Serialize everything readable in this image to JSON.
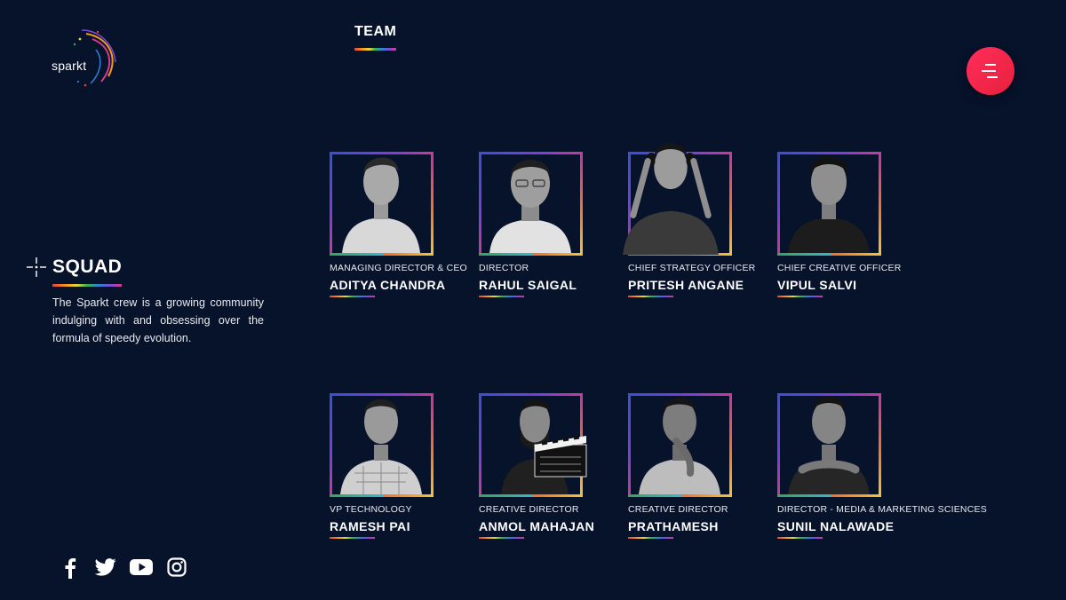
{
  "brand": {
    "logo_text": "sparkt"
  },
  "nav": {
    "active_label": "TEAM"
  },
  "menu": {
    "icon": "menu-icon"
  },
  "intro": {
    "title": "SQUAD",
    "description": "The Sparkt crew is a growing community indulging with and obsessing over the formula of speedy evolution."
  },
  "team": [
    {
      "role": "MANAGING DIRECTOR & CEO",
      "name": "ADITYA CHANDRA"
    },
    {
      "role": "DIRECTOR",
      "name": "RAHUL SAIGAL"
    },
    {
      "role": "CHIEF STRATEGY OFFICER",
      "name": "PRITESH ANGANE"
    },
    {
      "role": "CHIEF CREATIVE OFFICER",
      "name": "VIPUL SALVI"
    },
    {
      "role": "VP TECHNOLOGY",
      "name": "RAMESH PAI"
    },
    {
      "role": "CREATIVE DIRECTOR",
      "name": "ANMOL MAHAJAN"
    },
    {
      "role": "CREATIVE DIRECTOR",
      "name": "PRATHAMESH"
    },
    {
      "role": "DIRECTOR - MEDIA & MARKETING SCIENCES",
      "name": "SUNIL NALAWADE"
    }
  ],
  "social": [
    "facebook-icon",
    "twitter-icon",
    "youtube-icon",
    "instagram-icon"
  ],
  "colors": {
    "background": "#07122b",
    "accent": "#ff2e5a"
  }
}
